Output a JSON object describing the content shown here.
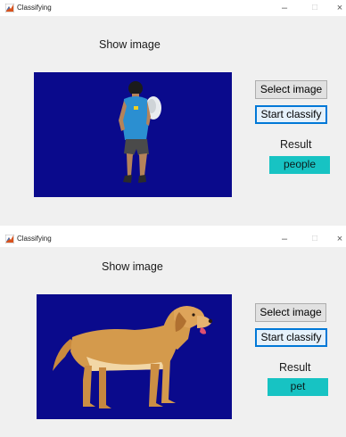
{
  "windows": [
    {
      "title": "Classifying",
      "controls": {
        "minimize": "–",
        "maximize": "□",
        "close": "×"
      },
      "show_image_label": "Show image",
      "buttons": {
        "select": "Select image",
        "classify": "Start classify"
      },
      "result_label": "Result",
      "result_value": "people"
    },
    {
      "title": "Classifying",
      "controls": {
        "minimize": "–",
        "maximize": "□",
        "close": "×"
      },
      "show_image_label": "Show image",
      "buttons": {
        "select": "Select image",
        "classify": "Start classify"
      },
      "result_label": "Result",
      "result_value": "pet"
    }
  ],
  "colors": {
    "image_background": "#0a0a8c",
    "result_background": "#17c3c3",
    "focus_border": "#0078d7"
  }
}
